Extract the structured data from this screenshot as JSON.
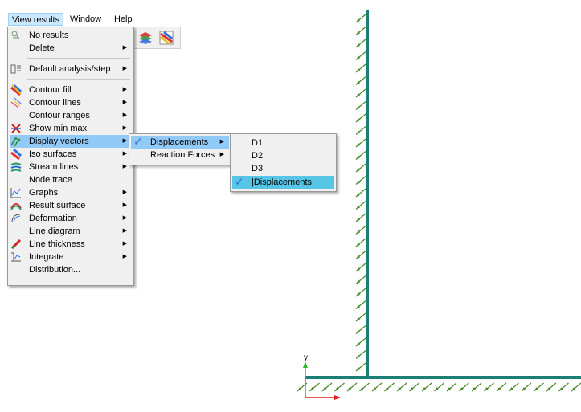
{
  "menubar": {
    "items": [
      "View results",
      "Window",
      "Help"
    ]
  },
  "view_results_menu": {
    "items": [
      {
        "label": "No results",
        "icon": "no-results-icon",
        "submenu": false
      },
      {
        "label": "Delete",
        "icon": "",
        "submenu": true
      },
      {
        "label": "Default analysis/step",
        "icon": "default-analysis-icon",
        "submenu": true
      },
      {
        "label": "Contour fill",
        "icon": "contour-fill-icon",
        "submenu": true
      },
      {
        "label": "Contour lines",
        "icon": "contour-lines-icon",
        "submenu": true
      },
      {
        "label": "Contour ranges",
        "icon": "",
        "submenu": true
      },
      {
        "label": "Show min max",
        "icon": "min-max-icon",
        "submenu": true
      },
      {
        "label": "Display vectors",
        "icon": "display-vectors-icon",
        "submenu": true
      },
      {
        "label": "Iso surfaces",
        "icon": "iso-surfaces-icon",
        "submenu": true
      },
      {
        "label": "Stream lines",
        "icon": "stream-lines-icon",
        "submenu": true
      },
      {
        "label": "Node trace",
        "icon": "",
        "submenu": false
      },
      {
        "label": "Graphs",
        "icon": "graphs-icon",
        "submenu": true
      },
      {
        "label": "Result surface",
        "icon": "result-surface-icon",
        "submenu": true
      },
      {
        "label": "Deformation",
        "icon": "deformation-icon",
        "submenu": true
      },
      {
        "label": "Line diagram",
        "icon": "",
        "submenu": true
      },
      {
        "label": "Line thickness",
        "icon": "line-thickness-icon",
        "submenu": true
      },
      {
        "label": "Integrate",
        "icon": "integrate-icon",
        "submenu": true
      },
      {
        "label": "Distribution...",
        "icon": "",
        "submenu": false
      }
    ]
  },
  "display_vectors_menu": {
    "items": [
      {
        "label": "Displacements",
        "checked": true
      },
      {
        "label": "Reaction Forces",
        "checked": false
      }
    ]
  },
  "displacements_menu": {
    "items": [
      {
        "label": "D1",
        "checked": false
      },
      {
        "label": "D2",
        "checked": false
      },
      {
        "label": "D3",
        "checked": false
      },
      {
        "label": "|Displacements|",
        "checked": true
      }
    ]
  },
  "viewport": {
    "axis_y_label": "y",
    "model_color": "#1a7f74",
    "vector_color": "#4a8a2a"
  }
}
